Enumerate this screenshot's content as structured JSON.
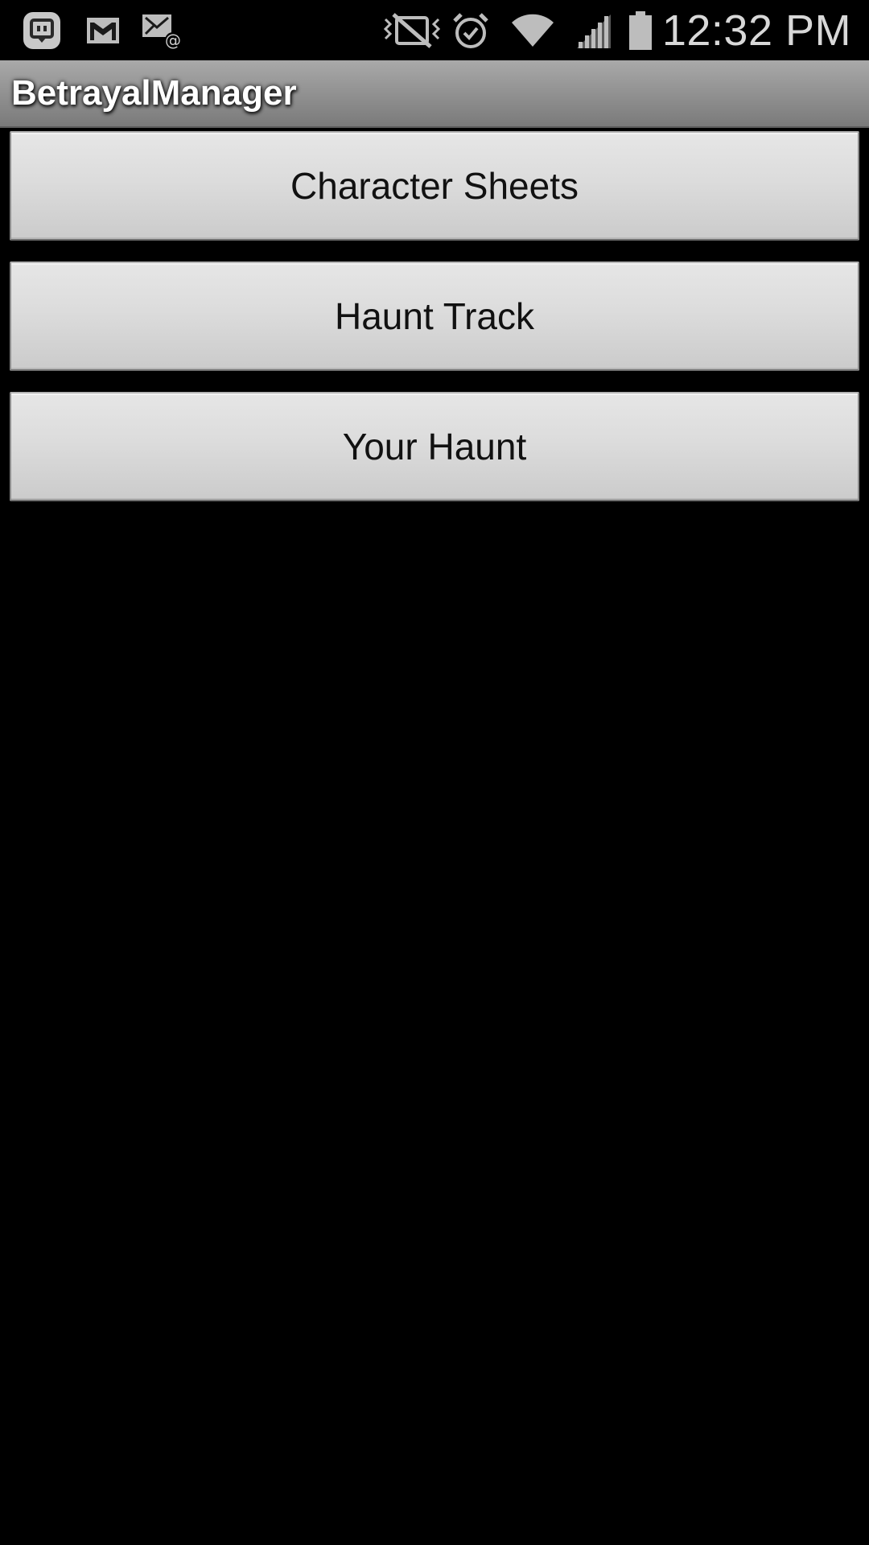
{
  "status_bar": {
    "time": "12:32 PM",
    "left_icons": [
      "chat-notification-icon",
      "gmail-icon",
      "email-icon"
    ],
    "right_icons": [
      "vibrate-icon",
      "alarm-icon",
      "wifi-icon",
      "cell-signal-icon",
      "battery-icon"
    ]
  },
  "action_bar": {
    "title": "BetrayalManager"
  },
  "menu": {
    "items": [
      {
        "label": "Character Sheets"
      },
      {
        "label": "Haunt Track"
      },
      {
        "label": "Your Haunt"
      }
    ]
  },
  "colors": {
    "background": "#000000",
    "action_bar": "#8f8f8f",
    "button_face": "#dcdcdc",
    "button_text": "#111111",
    "status_text": "#d8d8d8"
  }
}
